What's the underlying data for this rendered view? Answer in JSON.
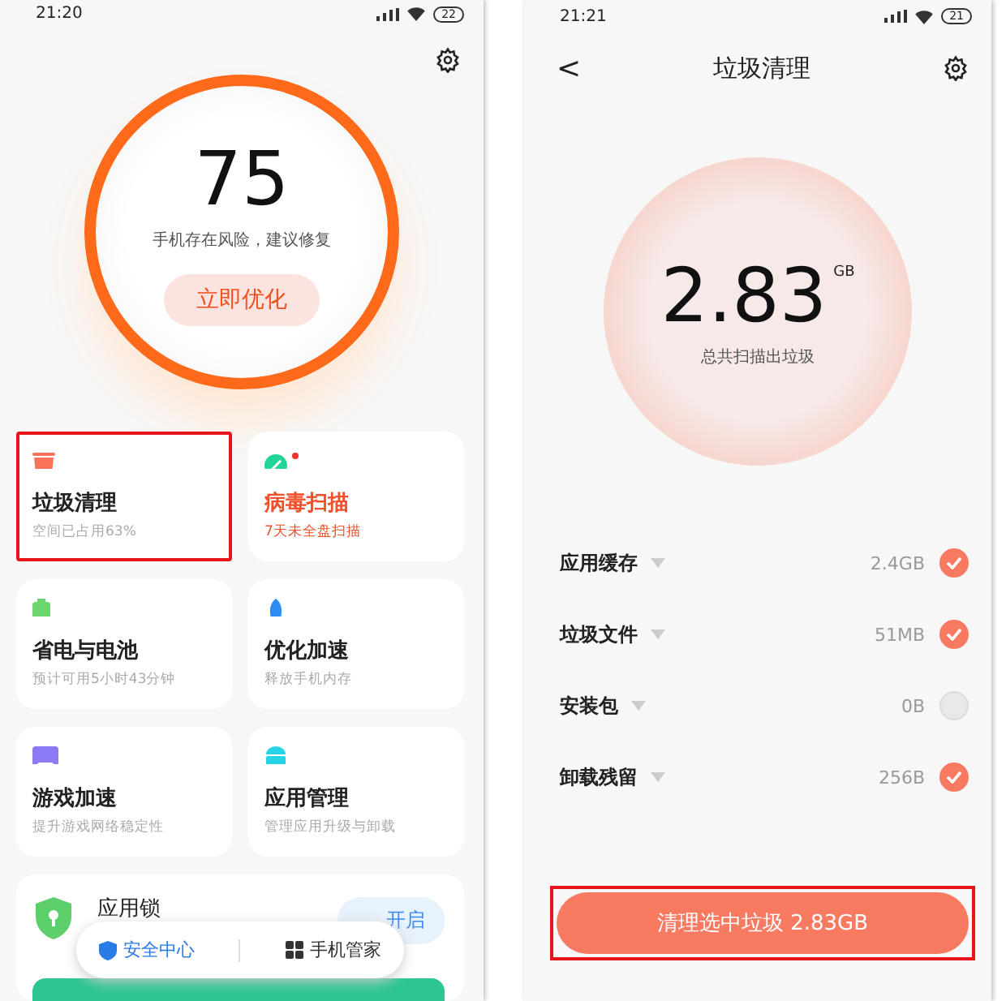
{
  "left": {
    "status_bar": {
      "time": "21:20",
      "battery": "22"
    },
    "score": {
      "value": "75",
      "message": "手机存在风险，建议修复",
      "button": "立即优化"
    },
    "cards": [
      {
        "title": "垃圾清理",
        "subtitle": "空间已占用63%",
        "alert": false,
        "highlighted": true
      },
      {
        "title": "病毒扫描",
        "subtitle": "7天未全盘扫描",
        "alert": true,
        "highlighted": false
      },
      {
        "title": "省电与电池",
        "subtitle": "预计可用5小时43分钟",
        "alert": false,
        "highlighted": false
      },
      {
        "title": "优化加速",
        "subtitle": "释放手机内存",
        "alert": false,
        "highlighted": false
      },
      {
        "title": "游戏加速",
        "subtitle": "提升游戏网络稳定性",
        "alert": false,
        "highlighted": false
      },
      {
        "title": "应用管理",
        "subtitle": "管理应用升级与卸载",
        "alert": false,
        "highlighted": false
      }
    ],
    "app_lock": {
      "title": "应用锁",
      "button": "开启"
    },
    "bottom_tabs": [
      {
        "label": "安全中心",
        "selected": true
      },
      {
        "label": "手机管家",
        "selected": false
      }
    ]
  },
  "right": {
    "status_bar": {
      "time": "21:21",
      "battery": "21"
    },
    "header": {
      "back": "<",
      "title": "垃圾清理"
    },
    "total": {
      "value": "2.83",
      "unit": "GB",
      "caption": "总共扫描出垃圾"
    },
    "items": [
      {
        "name": "应用缓存",
        "size": "2.4GB",
        "checked": true
      },
      {
        "name": "垃圾文件",
        "size": "51MB",
        "checked": true
      },
      {
        "name": "安装包",
        "size": "0B",
        "checked": false
      },
      {
        "name": "卸载残留",
        "size": "256B",
        "checked": true
      }
    ],
    "clean_button": {
      "label": "清理选中垃圾 2.83GB",
      "highlighted": true
    }
  }
}
